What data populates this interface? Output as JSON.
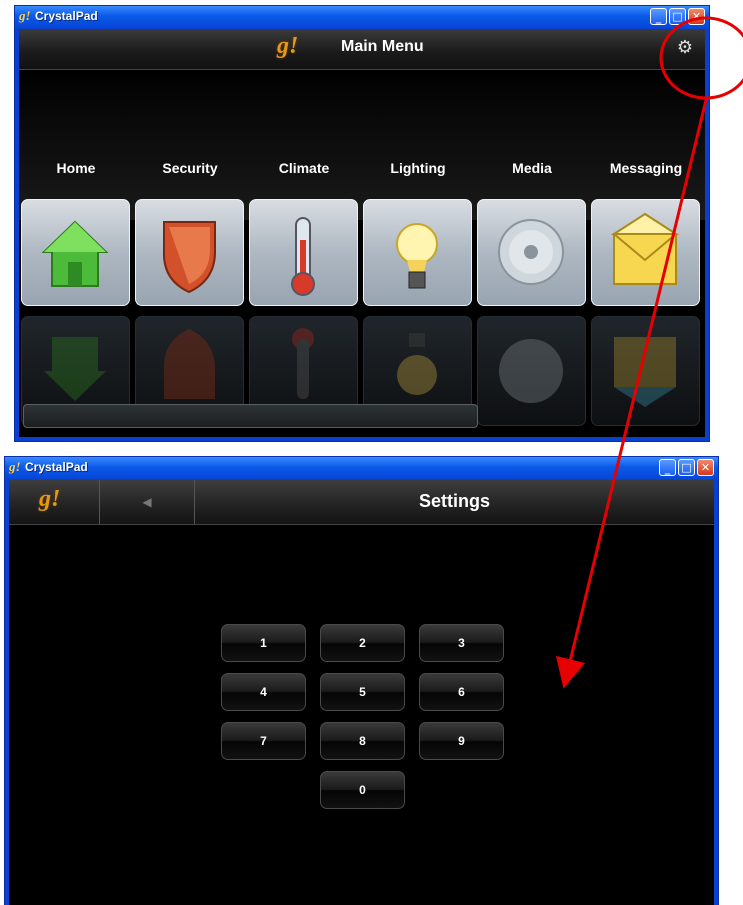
{
  "top_window": {
    "title": "CrystalPad",
    "logo": "g!",
    "header_title": "Main Menu",
    "settings_icon": "gear-icon",
    "tiles": [
      {
        "label": "Home",
        "icon": "house-icon"
      },
      {
        "label": "Security",
        "icon": "shield-icon"
      },
      {
        "label": "Climate",
        "icon": "thermometer-icon"
      },
      {
        "label": "Lighting",
        "icon": "light-bulb-icon"
      },
      {
        "label": "Media",
        "icon": "disc-icon"
      },
      {
        "label": "Messaging",
        "icon": "envelope-icon"
      }
    ]
  },
  "bottom_window": {
    "title": "CrystalPad",
    "logo": "g!",
    "back_icon": "back-arrow-icon",
    "header_title": "Settings",
    "keypad": [
      "1",
      "2",
      "3",
      "4",
      "5",
      "6",
      "7",
      "8",
      "9",
      "0"
    ]
  },
  "annotation": {
    "color": "#e60000",
    "shapes": [
      "circle-around-settings-icon",
      "arrow-to-settings-screen"
    ]
  },
  "colors": {
    "title_bar_blue": "#0a5ae8",
    "logo_orange": "#e39a1b",
    "close_red": "#d2391b"
  }
}
